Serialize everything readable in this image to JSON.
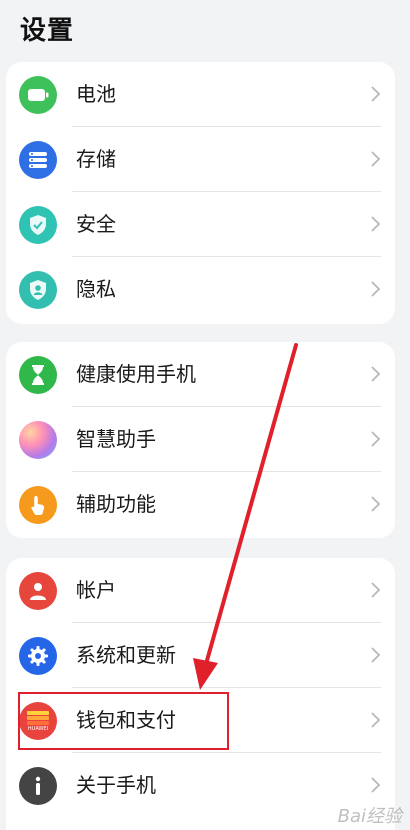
{
  "header": {
    "title": "设置"
  },
  "groups": [
    {
      "items": [
        {
          "label": "电池",
          "icon": "battery-icon",
          "color": "#3ec05a"
        },
        {
          "label": "存储",
          "icon": "storage-icon",
          "color": "#2f6fe6"
        },
        {
          "label": "安全",
          "icon": "security-shield-icon",
          "color": "#2ec3b2"
        },
        {
          "label": "隐私",
          "icon": "privacy-icon",
          "color": "#33bfb0"
        }
      ]
    },
    {
      "items": [
        {
          "label": "健康使用手机",
          "icon": "hourglass-icon",
          "color": "#30b94a"
        },
        {
          "label": "智慧助手",
          "icon": "assistant-orb-icon",
          "color": "#b47ae8"
        },
        {
          "label": "辅助功能",
          "icon": "accessibility-hand-icon",
          "color": "#f59a1c"
        }
      ]
    },
    {
      "items": [
        {
          "label": "帐户",
          "icon": "account-person-icon",
          "color": "#e6463c"
        },
        {
          "label": "系统和更新",
          "icon": "system-gear-icon",
          "color": "#2566e8"
        },
        {
          "label": "钱包和支付",
          "icon": "huawei-wallet-icon",
          "color": "#e8433c",
          "icon_text": "HUAWEI"
        },
        {
          "label": "关于手机",
          "icon": "info-icon",
          "color": "#444444"
        }
      ]
    }
  ],
  "watermark": "Bai经验"
}
